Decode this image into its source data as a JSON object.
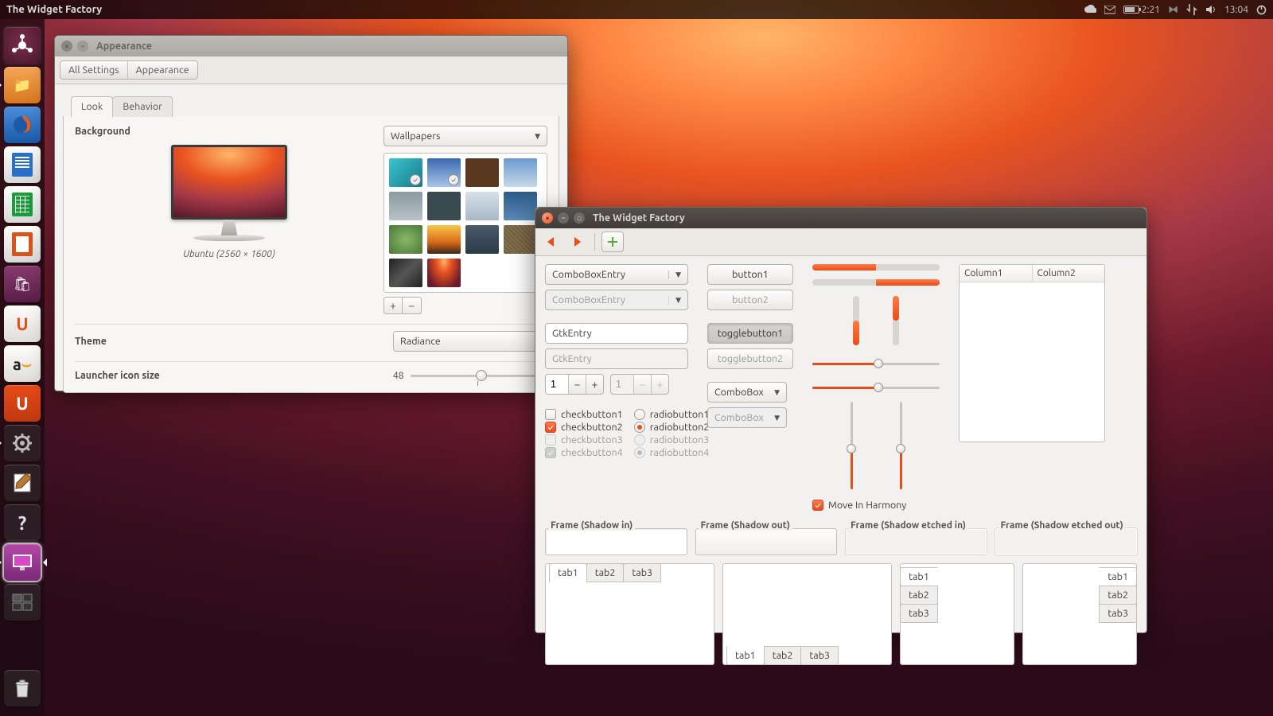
{
  "panel": {
    "app_title": "The Widget Factory",
    "battery_time": "2:21",
    "clock": "13:04"
  },
  "launcher": {
    "items": [
      {
        "name": "dash",
        "label": "Dash"
      },
      {
        "name": "files",
        "label": "Files"
      },
      {
        "name": "firefox",
        "label": "Firefox"
      },
      {
        "name": "writer",
        "label": "LibreOffice Writer"
      },
      {
        "name": "calc",
        "label": "LibreOffice Calc"
      },
      {
        "name": "impress",
        "label": "LibreOffice Impress"
      },
      {
        "name": "software-center",
        "label": "Ubuntu Software Center"
      },
      {
        "name": "ubuntu-one",
        "label": "Ubuntu One"
      },
      {
        "name": "amazon",
        "label": "Amazon"
      },
      {
        "name": "ubuntu-one-music",
        "label": "Ubuntu One Music"
      },
      {
        "name": "settings",
        "label": "System Settings"
      },
      {
        "name": "text-editor",
        "label": "Text Editor"
      },
      {
        "name": "help",
        "label": "Help"
      },
      {
        "name": "appearance",
        "label": "Appearance"
      },
      {
        "name": "workspace",
        "label": "Workspace Switcher"
      }
    ],
    "trash": "Trash"
  },
  "appearance": {
    "title": "Appearance",
    "breadcrumb": [
      "All Settings",
      "Appearance"
    ],
    "tabs": [
      "Look",
      "Behavior"
    ],
    "background_label": "Background",
    "source_combo": "Wallpapers",
    "caption": "Ubuntu (2560 × 1600)",
    "add": "+",
    "remove": "−",
    "theme_label": "Theme",
    "theme_value": "Radiance",
    "launcher_label": "Launcher icon size",
    "launcher_value": "48"
  },
  "wf": {
    "title": "The Widget Factory",
    "combo1": "ComboBoxEntry",
    "combo2": "ComboBoxEntry",
    "entry1": "GtkEntry",
    "entry2_placeholder": "GtkEntry",
    "spin1": "1",
    "spin2": "1",
    "check": [
      "checkbutton1",
      "checkbutton2",
      "checkbutton3",
      "checkbutton4"
    ],
    "radio": [
      "radiobutton1",
      "radiobutton2",
      "radiobutton3",
      "radiobutton4"
    ],
    "button1": "button1",
    "button2": "button2",
    "toggle1": "togglebutton1",
    "toggle2": "togglebutton2",
    "combo3": "ComboBox",
    "combo4": "ComboBox",
    "harmony": "Move In Harmony",
    "columns": [
      "Column1",
      "Column2"
    ],
    "frames": [
      "Frame (Shadow in)",
      "Frame (Shadow out)",
      "Frame (Shadow etched in)",
      "Frame (Shadow etched out)"
    ],
    "tabs": [
      "tab1",
      "tab2",
      "tab3"
    ]
  }
}
